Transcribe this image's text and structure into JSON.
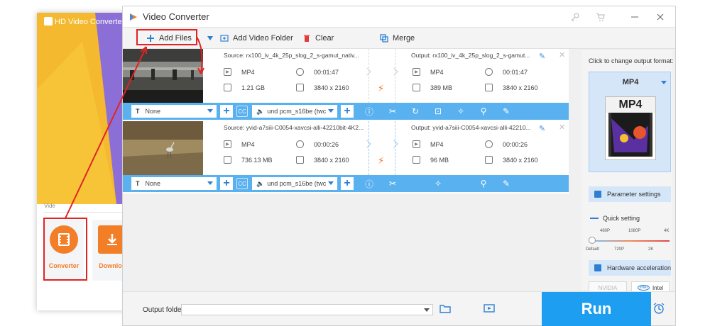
{
  "launcher": {
    "title": "HD Video Converter Fa",
    "section": "Vide",
    "tiles": [
      {
        "label": "Converter",
        "icon": "film-icon"
      },
      {
        "label": "Downloa",
        "icon": "download-icon"
      }
    ]
  },
  "window": {
    "title": "Video Converter",
    "buttons": [
      "key-icon",
      "cart-icon",
      "minimize-icon",
      "close-icon"
    ]
  },
  "toolbar": {
    "add_files": "Add Files",
    "add_video_folder": "Add Video Folder",
    "clear": "Clear",
    "merge": "Merge"
  },
  "files": [
    {
      "source": "Source: rx100_iv_4k_25p_slog_2_s-gamut_nativ...",
      "output": "Output: rx100_iv_4k_25p_slog_2_s-gamut...",
      "src_format": "MP4",
      "src_duration": "00:01:47",
      "src_size": "1.21 GB",
      "src_res": "3840 x 2160",
      "out_format": "MP4",
      "out_duration": "00:01:47",
      "out_size": "389 MB",
      "out_res": "3840 x 2160",
      "subtitle": "None",
      "audio": "und pcm_s16be (twc"
    },
    {
      "source": "Source: yvid-a7siii-C0054-xavcsi-alli-42210bit-4K2...",
      "output": "Output: yvid-a7siii-C0054-xavcsi-alli-42210...",
      "src_format": "MP4",
      "src_duration": "00:00:26",
      "src_size": "736.13 MB",
      "src_res": "3840 x 2160",
      "out_format": "MP4",
      "out_duration": "00:00:26",
      "out_size": "96 MB",
      "out_res": "3840 x 2160",
      "subtitle": "None",
      "audio": "und pcm_s16be (twc"
    }
  ],
  "right_panel": {
    "change_format": "Click to change output format:",
    "format": "MP4",
    "poster_text": "MP4",
    "parameter_settings": "Parameter settings",
    "quick_setting": "Quick setting",
    "quality_top": [
      "480P",
      "1080P",
      "4K"
    ],
    "quality_bottom": [
      "Default",
      "720P",
      "2K"
    ],
    "hardware_acceleration": "Hardware acceleration",
    "gpu_nvidia": "NVIDIA",
    "gpu_intel": "Intel"
  },
  "bottom": {
    "output_folder_label": "Output folder:",
    "run": "Run"
  },
  "colors": {
    "accent": "#1e9ef0",
    "bar": "#5ab1f0",
    "orange": "#f27e28",
    "annotation": "#e02424"
  }
}
